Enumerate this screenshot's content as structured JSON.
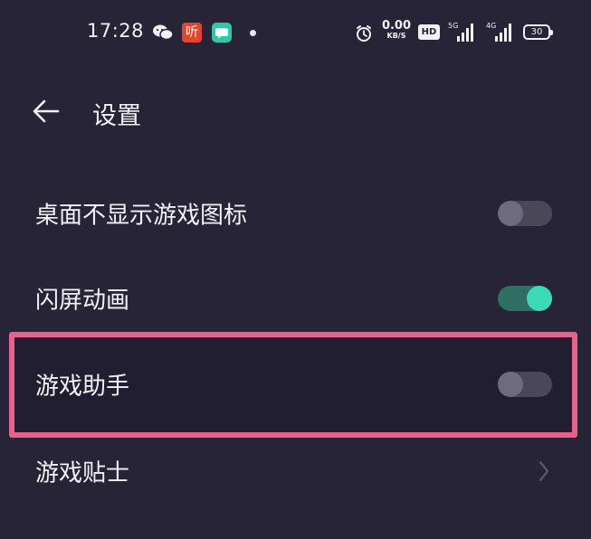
{
  "status_bar": {
    "time": "17:28",
    "ting_label": "听",
    "net_speed_value": "0.00",
    "net_speed_unit": "KB/S",
    "hd_label": "HD",
    "sig1_label": "5G",
    "sig2_label": "4G",
    "battery": "30",
    "icons": [
      "wechat-icon",
      "ting-app-icon",
      "message-app-icon",
      "notification-dot-icon",
      "alarm-icon",
      "hd-icon",
      "signal-5g-icon",
      "signal-4g-icon",
      "battery-icon"
    ]
  },
  "header": {
    "title": "设置",
    "back_icon": "arrow-left-icon"
  },
  "settings": {
    "items": [
      {
        "label": "桌面不显示游戏图标",
        "control": "toggle",
        "state": "off"
      },
      {
        "label": "闪屏动画",
        "control": "toggle",
        "state": "on"
      },
      {
        "label": "游戏助手",
        "control": "toggle",
        "state": "off",
        "highlighted": true
      },
      {
        "label": "游戏贴士",
        "control": "chevron",
        "icon": "chevron-right-icon"
      }
    ]
  },
  "colors": {
    "background": "#272438",
    "toggle_on_accent": "#3ddab9",
    "highlight_border": "#e5628a"
  }
}
